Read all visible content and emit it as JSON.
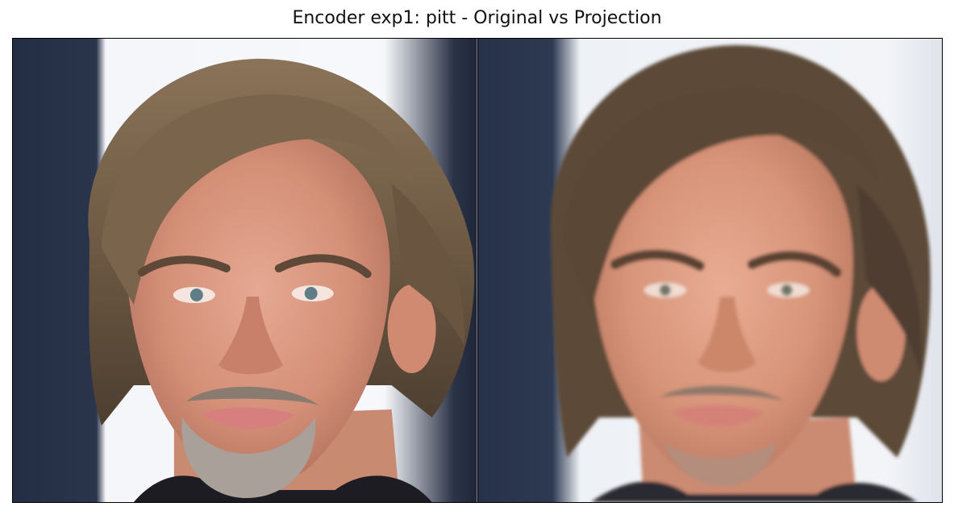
{
  "title": "Encoder exp1: pitt - Original vs Projection",
  "panels": [
    {
      "id": "original",
      "content": "photo-portrait"
    },
    {
      "id": "projection",
      "content": "reconstructed-portrait"
    }
  ],
  "colors": {
    "background": "#ffffff",
    "frame": "#000000",
    "backdrop_dark": "#26324a",
    "backdrop_light": "#f2f4f8",
    "skin": "#d99a82",
    "hair": "#6b5845"
  }
}
